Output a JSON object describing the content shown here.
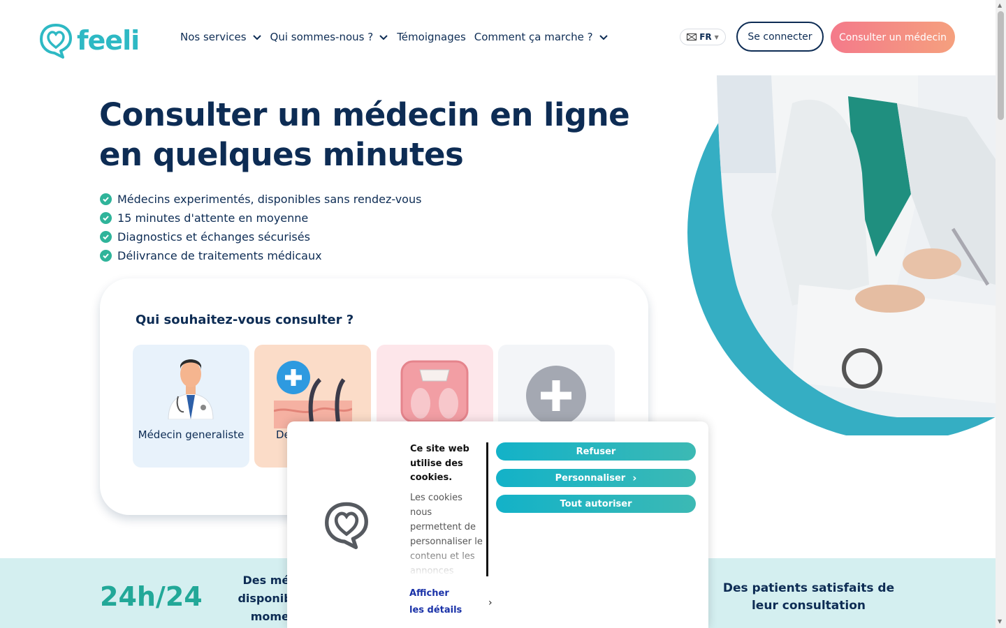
{
  "header": {
    "logo_text": "feeli",
    "nav": [
      {
        "label": "Nos services",
        "has_dropdown": true
      },
      {
        "label": "Qui sommes-nous ?",
        "has_dropdown": true
      },
      {
        "label": "Témoignages",
        "has_dropdown": false
      },
      {
        "label": "Comment ça marche ?",
        "has_dropdown": true
      }
    ],
    "language": "FR",
    "login_label": "Se connecter",
    "consult_label": "Consulter un médecin"
  },
  "hero": {
    "title": "Consulter un médecin en ligne en quelques minutes",
    "features": [
      "Médecins experimentés, disponibles sans rendez-vous",
      "15 minutes d'attente en moyenne",
      "Diagnostics et échanges sécurisés",
      "Délivrance de traitements médicaux"
    ]
  },
  "consult_card": {
    "title": "Qui souhaitez-vous consulter ?",
    "tiles": [
      {
        "label": "Médecin generaliste",
        "icon": "doctor-icon",
        "bg": "#e8f2fb"
      },
      {
        "label": "De",
        "icon": "dermatology-icon",
        "bg": "#fbdcc8"
      },
      {
        "label": "",
        "icon": "weight-scale-icon",
        "bg": "#fde6ea"
      },
      {
        "label": "",
        "icon": "plus-icon",
        "bg": "#f3f5f8"
      }
    ]
  },
  "stats": {
    "big_value": "24h/24",
    "text_1": "Des méde disponibles momen",
    "text_2": "Des patients satisfaits de leur consultation"
  },
  "cookie_banner": {
    "title": "Ce site web utilise des cookies.",
    "body": "Les cookies nous permettent de personnaliser le contenu et les annonces",
    "details_label": "Afficher les détails",
    "buttons": {
      "refuse": "Refuser",
      "customize": "Personnaliser",
      "accept_all": "Tout autoriser"
    }
  },
  "colors": {
    "navy": "#0d2c54",
    "teal": "#2eb9c4",
    "accent_gradient_start": "#f47a8a",
    "accent_gradient_end": "#f5a07e",
    "check_green": "#2fb49a"
  }
}
